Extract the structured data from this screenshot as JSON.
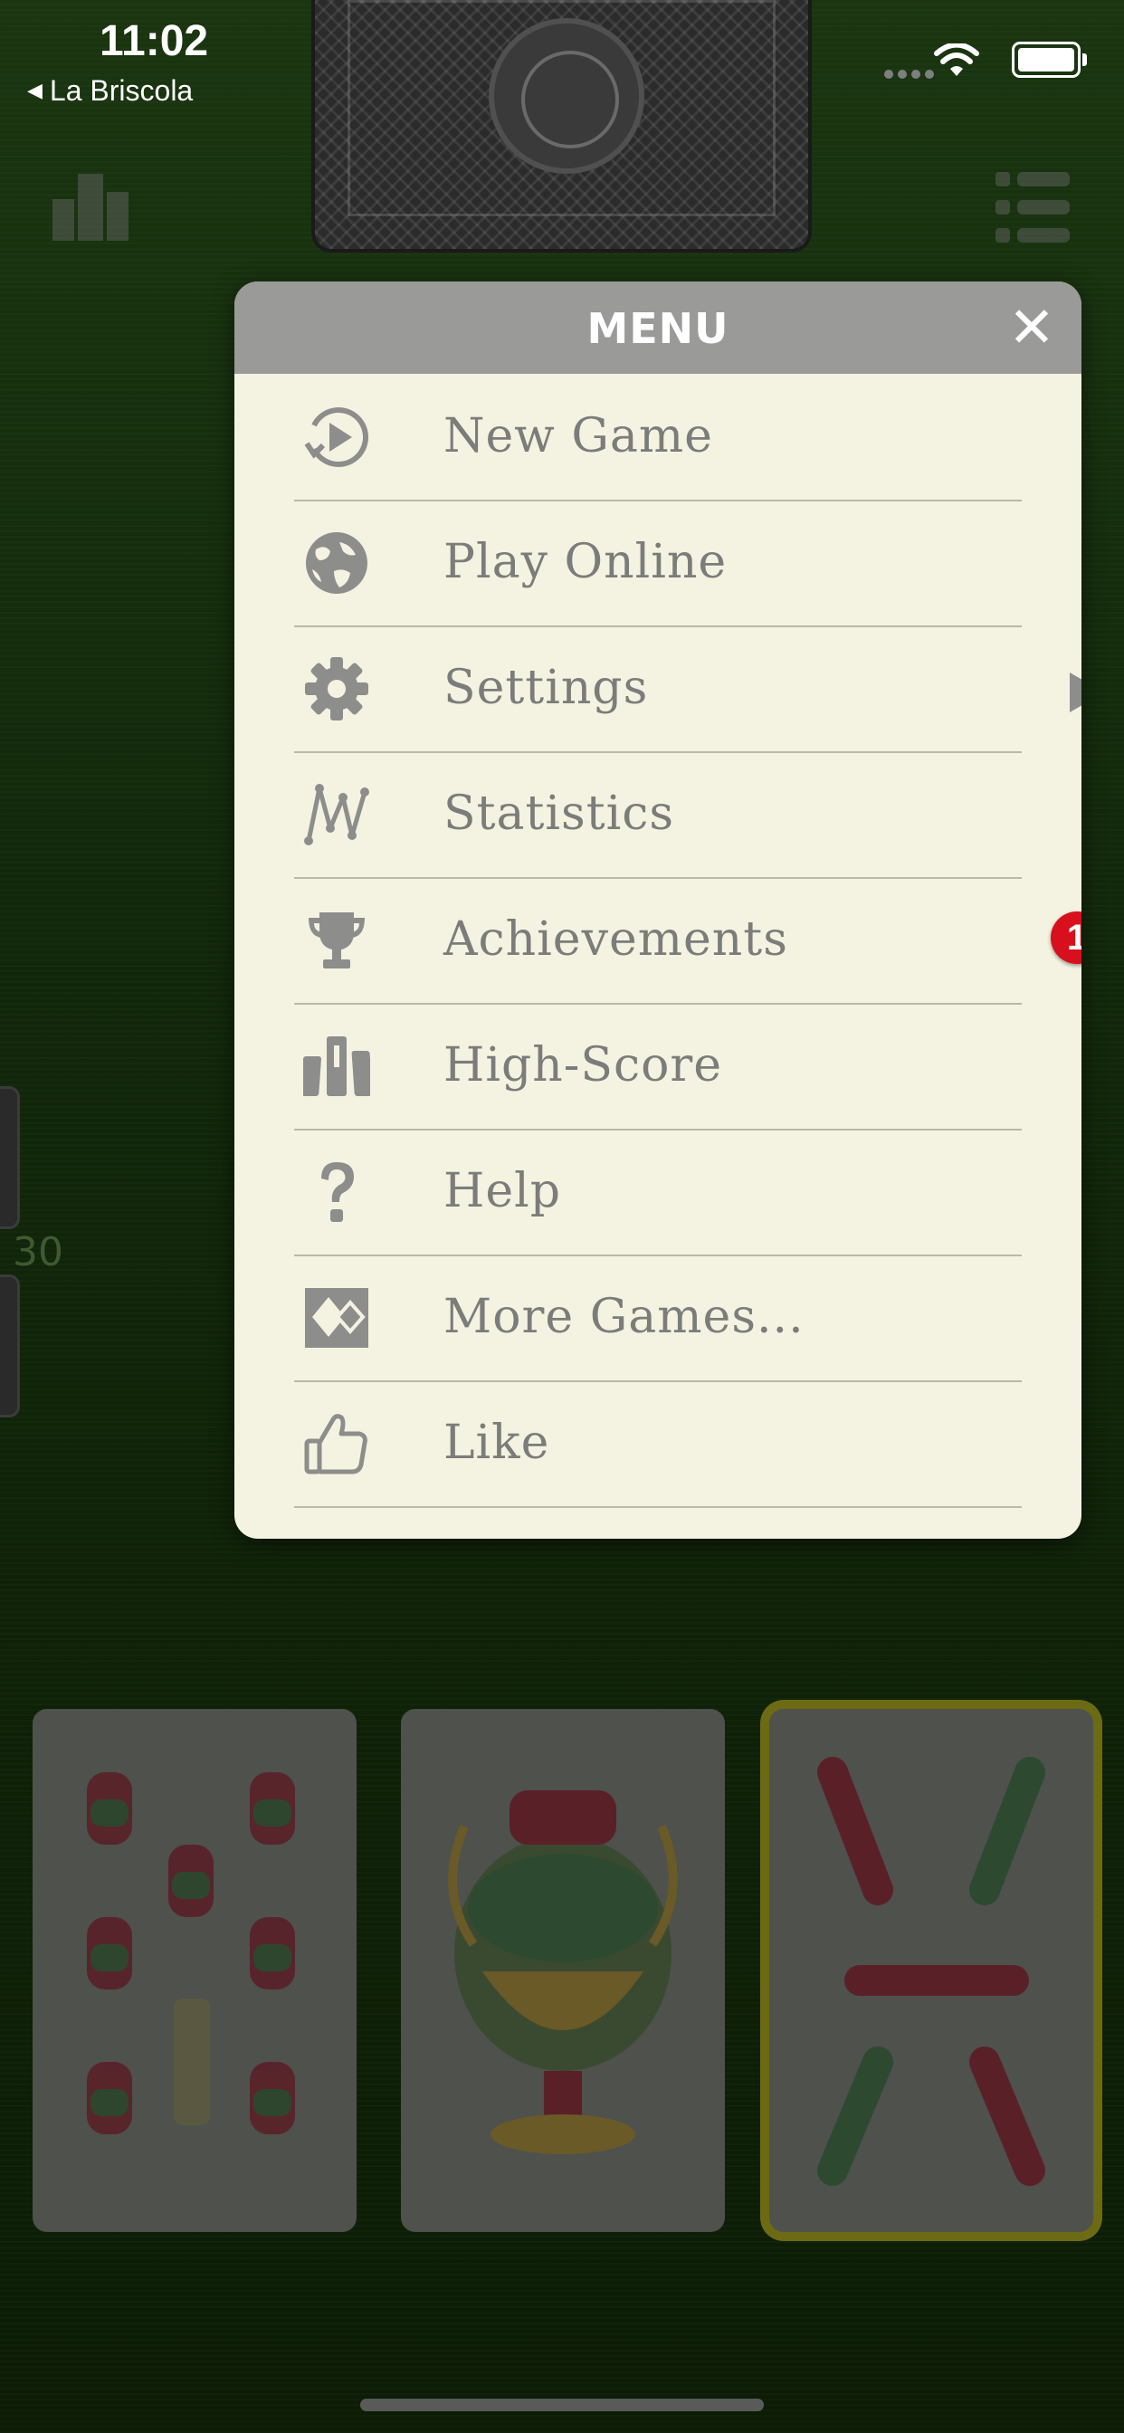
{
  "status_bar": {
    "time": "11:02",
    "back_app": "La Briscola"
  },
  "background": {
    "side_score": "30"
  },
  "menu": {
    "title": "MENU",
    "close_glyph": "✕",
    "items": [
      {
        "label": "New Game",
        "icon": "play-circle-icon"
      },
      {
        "label": "Play Online",
        "icon": "globe-icon"
      },
      {
        "label": "Settings",
        "icon": "gear-icon"
      },
      {
        "label": "Statistics",
        "icon": "statistics-icon"
      },
      {
        "label": "Achievements",
        "icon": "trophy-icon",
        "badge": "1"
      },
      {
        "label": "High-Score",
        "icon": "podium-icon"
      },
      {
        "label": "Help",
        "icon": "question-icon"
      },
      {
        "label": "More Games...",
        "icon": "more-games-icon"
      },
      {
        "label": "Like",
        "icon": "thumbs-up-icon"
      }
    ]
  },
  "colors": {
    "menu_bg": "#f4f3e2",
    "menu_header": "#9a9a98",
    "badge": "#d8101d",
    "felt": "#11270a"
  }
}
